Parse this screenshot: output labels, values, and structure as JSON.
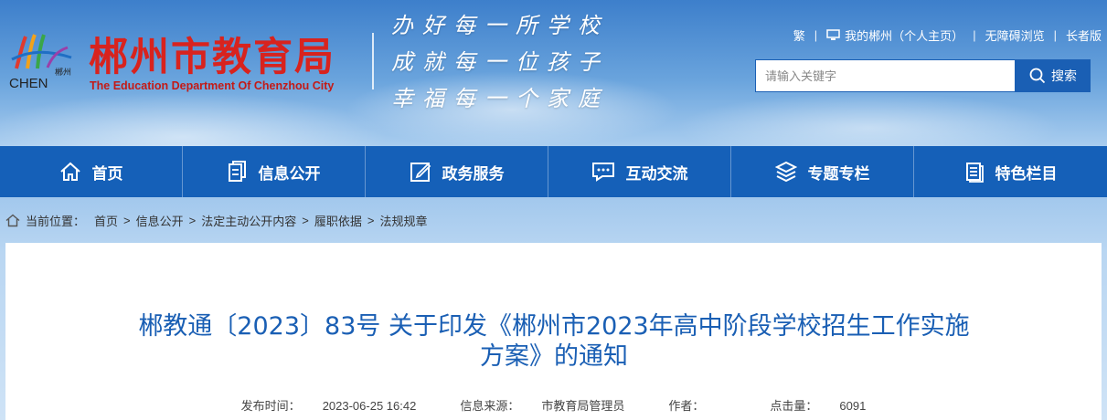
{
  "header": {
    "logo_small_cn": "郴州",
    "logo_small_en": "CHEN",
    "title_cn": "郴州市教育局",
    "title_en": "The Education Department Of Chenzhou City",
    "slogans": [
      "办好每一所学校",
      "成就每一位孩子",
      "幸福每一个家庭"
    ],
    "colors": {
      "brand_red": "#d8231e",
      "brand_blue": "#1560b8"
    }
  },
  "toplinks": {
    "traditional": "繁",
    "my_chenzhou": "我的郴州（个人主页）",
    "accessible": "无障碍浏览",
    "elder": "长者版"
  },
  "search": {
    "placeholder": "请输入关键字",
    "button_label": "搜索"
  },
  "nav": {
    "items": [
      {
        "label": "首页",
        "icon": "home-icon"
      },
      {
        "label": "信息公开",
        "icon": "document-icon"
      },
      {
        "label": "政务服务",
        "icon": "edit-icon"
      },
      {
        "label": "互动交流",
        "icon": "chat-icon"
      },
      {
        "label": "专题专栏",
        "icon": "layers-icon"
      },
      {
        "label": "特色栏目",
        "icon": "book-icon"
      }
    ]
  },
  "breadcrumb": {
    "prefix": "当前位置：",
    "items": [
      "首页",
      "信息公开",
      "法定主动公开内容",
      "履职依据",
      "法规规章"
    ],
    "separator": ">"
  },
  "article": {
    "title_line1": "郴教通〔2023〕83号 关于印发《郴州市2023年高中阶段学校招生工作实施",
    "title_line2": "方案》的通知",
    "published_label": "发布时间：",
    "published_value": "2023-06-25 16:42",
    "source_label": "信息来源：",
    "source_value": "市教育局管理员",
    "author_label": "作者：",
    "author_value": "",
    "clicks_label": "点击量：",
    "clicks_value": "6091"
  }
}
